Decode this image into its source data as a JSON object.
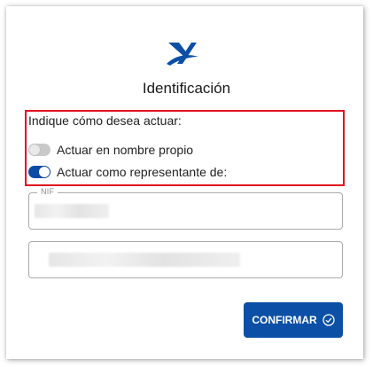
{
  "header": {
    "logo_icon": "agencia-tributaria-logo-icon",
    "title": "Identificación"
  },
  "options": {
    "prompt": "Indique cómo desea actuar:",
    "items": [
      {
        "label": "Actuar en nombre propio",
        "state": "off"
      },
      {
        "label": "Actuar como representante de:",
        "state": "on"
      }
    ]
  },
  "fields": {
    "nif_label": "NIF",
    "nif_value_redacted": true,
    "name_value_redacted": true
  },
  "actions": {
    "confirm_label": "CONFIRMAR",
    "confirm_icon": "check-circle-icon"
  },
  "colors": {
    "accent": "#0c4fa6",
    "highlight": "#e0101e",
    "toggle_off": "#c9c9c9"
  }
}
